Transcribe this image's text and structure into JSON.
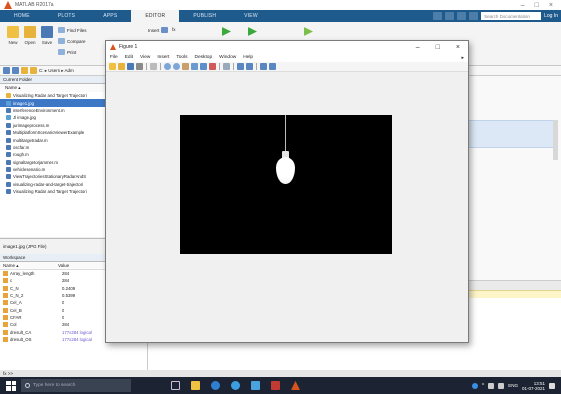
{
  "app": {
    "title": "MATLAB R2017a"
  },
  "tabs": [
    {
      "label": "HOME"
    },
    {
      "label": "PLOTS"
    },
    {
      "label": "APPS"
    },
    {
      "label": "EDITOR"
    },
    {
      "label": "PUBLISH"
    },
    {
      "label": "VIEW"
    }
  ],
  "header": {
    "search_placeholder": "Search Documentation",
    "login_label": "Log In"
  },
  "ribbon": {
    "new_label": "New",
    "open_label": "Open",
    "save_label": "Save",
    "find_files_label": "Find Files",
    "compare_label": "Compare",
    "print_label": "Print",
    "insert_label": "Insert",
    "fx_label": "fx"
  },
  "address": {
    "path": "C: ▸ Users ▸ Adm"
  },
  "current_folder": {
    "title": "Current Folder",
    "column": "Name ▴",
    "items": [
      {
        "label": "Visualizing Radar and Target Trajectori",
        "type": "folder",
        "selected": false
      },
      {
        "label": "image1.jpg",
        "type": "img",
        "selected": true
      },
      {
        "label": "interferenceEnvironment.m",
        "type": "m",
        "selected": false
      },
      {
        "label": "Jl image.jpg",
        "type": "img",
        "selected": false
      },
      {
        "label": "jurimageprocess.m",
        "type": "m",
        "selected": false
      },
      {
        "label": "MultiplatformScenarioViewerExample",
        "type": "m",
        "selected": false
      },
      {
        "label": "multitargetradar.m",
        "type": "m",
        "selected": false
      },
      {
        "label": "oscfar.m",
        "type": "m",
        "selected": false
      },
      {
        "label": "rough.m",
        "type": "m",
        "selected": false
      },
      {
        "label": "signaltargetorjammer.m",
        "type": "m",
        "selected": false
      },
      {
        "label": "vehiclesenario.m",
        "type": "m",
        "selected": false
      },
      {
        "label": "ViewTrajectoriesStationaryRadarAndS",
        "type": "m",
        "selected": false
      },
      {
        "label": "visualizing-radar-and-target-trajectori",
        "type": "m",
        "selected": false
      },
      {
        "label": "Visualizing Radar and Target Trajectori",
        "type": "m",
        "selected": false
      }
    ],
    "details": "image1.jpg (JPG File)"
  },
  "workspace": {
    "title": "Workspace",
    "col_name": "Name ▴",
    "col_value": "Value",
    "rows": [
      {
        "name": "Array_length",
        "value": "284",
        "link": false
      },
      {
        "name": "c",
        "value": "284",
        "link": false
      },
      {
        "name": "C_N",
        "value": "0.2409",
        "link": false
      },
      {
        "name": "C_N_2",
        "value": "0.5399",
        "link": false
      },
      {
        "name": "Cel_A",
        "value": "0",
        "link": false
      },
      {
        "name": "Cel_B",
        "value": "0",
        "link": false
      },
      {
        "name": "CFAR",
        "value": "0",
        "link": false
      },
      {
        "name": "Col",
        "value": "284",
        "link": false
      },
      {
        "name": "dresult_CA",
        "value": "177x284 logical",
        "link": true
      },
      {
        "name": "dresult_OS",
        "value": "177x284 logical",
        "link": true
      }
    ]
  },
  "fx_bar": {
    "label": "fx >>"
  },
  "figure": {
    "title": "Figure 1",
    "menu": [
      "File",
      "Edit",
      "View",
      "Insert",
      "Tools",
      "Desktop",
      "Window",
      "Help"
    ],
    "image_desc": "black image with hanging light bulb"
  },
  "taskbar": {
    "search_placeholder": "Type here to search",
    "lang": "ENG",
    "time": "13:51",
    "date": "01-07-2021"
  },
  "colors": {
    "tabbar": "#1f5a8c",
    "selection": "#3d78c7",
    "taskbar": "#1c2433",
    "matlab_logo": "#d9531e"
  }
}
